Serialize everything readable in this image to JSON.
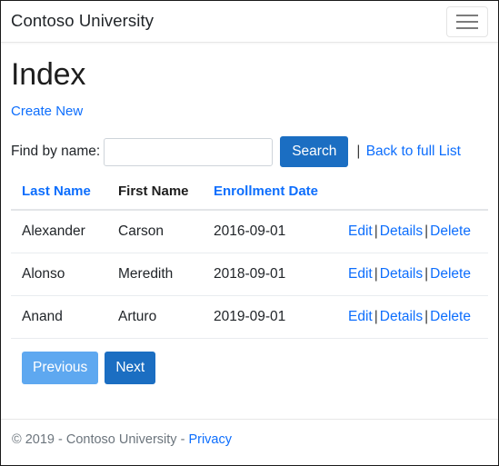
{
  "navbar": {
    "brand": "Contoso University",
    "toggler_icon": "hamburger-menu-icon"
  },
  "main": {
    "page_title": "Index",
    "create_new_label": "Create New",
    "search": {
      "label": "Find by name:",
      "value": "",
      "placeholder": "",
      "button_label": "Search",
      "separator": "|",
      "back_link_label": "Back to full List"
    },
    "table": {
      "columns": [
        {
          "label": "Last Name",
          "sortable": true
        },
        {
          "label": "First Name",
          "sortable": false
        },
        {
          "label": "Enrollment Date",
          "sortable": true
        },
        {
          "label": "",
          "sortable": false
        }
      ],
      "rows": [
        {
          "last_name": "Alexander",
          "first_name": "Carson",
          "enrollment_date": "2016-09-01",
          "actions": {
            "edit": "Edit",
            "details": "Details",
            "delete": "Delete",
            "separator": "|"
          }
        },
        {
          "last_name": "Alonso",
          "first_name": "Meredith",
          "enrollment_date": "2018-09-01",
          "actions": {
            "edit": "Edit",
            "details": "Details",
            "delete": "Delete",
            "separator": "|"
          }
        },
        {
          "last_name": "Anand",
          "first_name": "Arturo",
          "enrollment_date": "2019-09-01",
          "actions": {
            "edit": "Edit",
            "details": "Details",
            "delete": "Delete",
            "separator": "|"
          }
        }
      ]
    },
    "pager": {
      "previous_label": "Previous",
      "next_label": "Next",
      "previous_disabled": true
    }
  },
  "footer": {
    "copyright": "© 2019 - Contoso University - ",
    "privacy_label": "Privacy"
  },
  "colors": {
    "primary": "#1b6ec2",
    "link": "#0d6efd",
    "disabled_primary": "#5ea8f0",
    "text": "#212529",
    "muted": "#6c757d",
    "border": "#e7e7e7"
  }
}
